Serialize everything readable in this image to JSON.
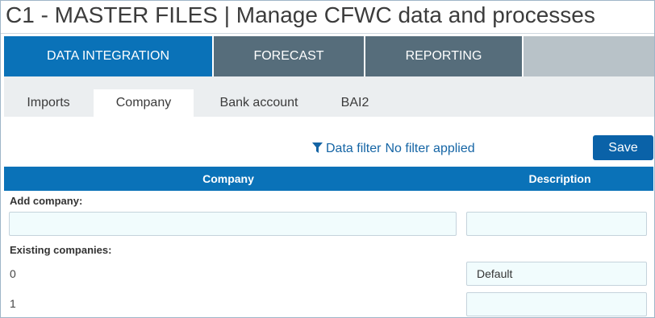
{
  "page": {
    "title": "C1 - MASTER FILES | Manage CFWC data and processes"
  },
  "main_tabs": [
    {
      "label": "DATA INTEGRATION",
      "active": true
    },
    {
      "label": "FORECAST",
      "active": false
    },
    {
      "label": "REPORTING",
      "active": false
    }
  ],
  "sub_tabs": [
    {
      "label": "Imports",
      "active": false
    },
    {
      "label": "Company",
      "active": true
    },
    {
      "label": "Bank account",
      "active": false
    },
    {
      "label": "BAI2",
      "active": false
    }
  ],
  "filter": {
    "icon": "filter-icon",
    "label": "Data filter",
    "status": "No filter applied"
  },
  "toolbar": {
    "save_label": "Save"
  },
  "table": {
    "headers": {
      "company": "Company",
      "description": "Description"
    },
    "add_label": "Add company:",
    "add_company_value": "",
    "add_description_value": "",
    "existing_label": "Existing companies:",
    "rows": [
      {
        "id": "0",
        "description": "Default"
      },
      {
        "id": "1",
        "description": ""
      }
    ]
  },
  "colors": {
    "primary": "#0a72b8",
    "tab_inactive": "#566d7b",
    "tab_filler": "#b8c2c8",
    "button": "#0a62a8",
    "link": "#1565a5",
    "input_bg": "#f1fcfd"
  }
}
